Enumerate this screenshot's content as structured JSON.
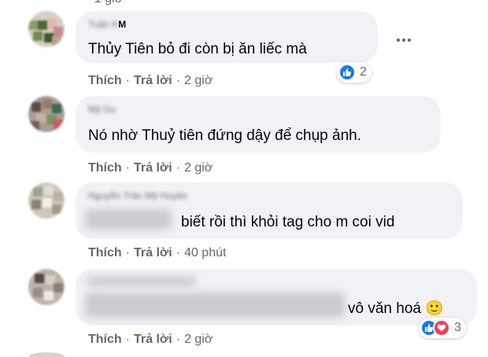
{
  "top_meta": "· 1 giờ",
  "comments": [
    {
      "author": "Tuấn K",
      "author_visible": "M",
      "text": "Thủy Tiên bỏ đi còn bị ăn liếc mà",
      "like_label": "Thích",
      "reply_label": "Trả lời",
      "time": "2 giờ",
      "reaction_count": "2"
    },
    {
      "author": "Mỹ Du",
      "text": "Nó nhờ Thuỷ tiên đứng dậy để chụp ảnh.",
      "like_label": "Thích",
      "reply_label": "Trả lời",
      "time": "2 giờ"
    },
    {
      "author": "Nguyễn Trần Mỹ Huyền",
      "text": "biết rồi thì khỏi tag cho m coi vid",
      "like_label": "Thích",
      "reply_label": "Trả lời",
      "time": "40 phút"
    },
    {
      "text": "vô văn hoá",
      "emoji": "🙂",
      "like_label": "Thích",
      "reply_label": "Trả lời",
      "time": "2 giờ",
      "reaction_count": "3"
    }
  ],
  "colors": {
    "bubble": "#f0f2f5",
    "meta_text": "#65676b",
    "like_blue": "#1877f2",
    "love_red": "#f33e58"
  }
}
